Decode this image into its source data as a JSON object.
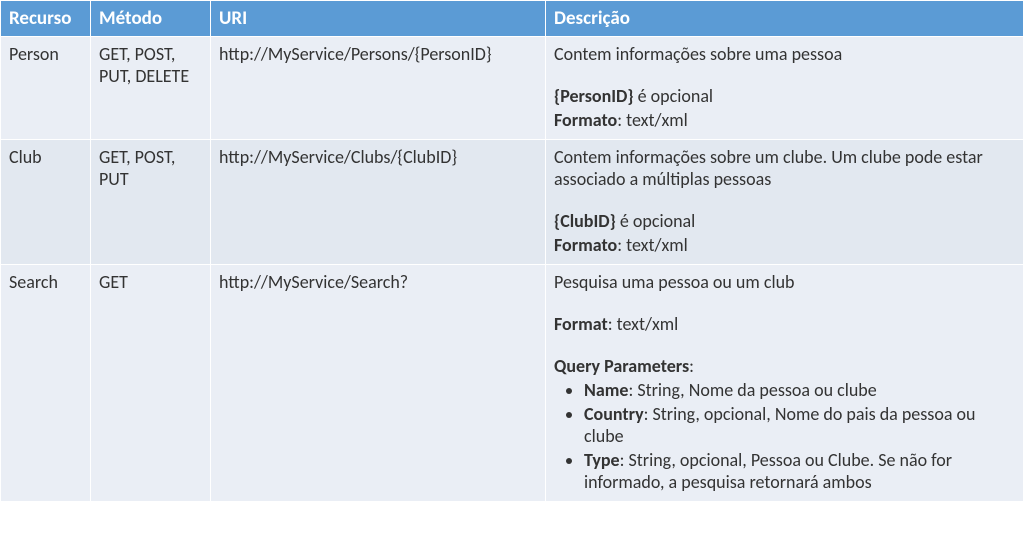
{
  "headers": {
    "recurso": "Recurso",
    "metodo": "Método",
    "uri": "URI",
    "descricao": "Descrição"
  },
  "rows": [
    {
      "recurso": "Person",
      "metodo": "GET, POST, PUT, DELETE",
      "uri": "http://MyService/Persons/{PersonID}",
      "desc": {
        "intro": "Contem informações sobre uma pessoa",
        "param_name": "{PersonID}",
        "param_suffix": " é opcional",
        "format_label": "Formato",
        "format_value": ": text/xml"
      }
    },
    {
      "recurso": "Club",
      "metodo": "GET, POST, PUT",
      "uri": "http://MyService/Clubs/{ClubID}",
      "desc": {
        "intro": "Contem informações sobre um clube. Um clube pode estar associado a múltiplas pessoas",
        "param_name": "{ClubID}",
        "param_suffix": " é opcional",
        "format_label": "Formato",
        "format_value": ": text/xml"
      }
    },
    {
      "recurso": "Search",
      "metodo": "GET",
      "uri": "http://MyService/Search?",
      "desc": {
        "intro": "Pesquisa uma pessoa ou um club",
        "format_label": "Format",
        "format_value": ": text/xml",
        "qp_label": "Query Parameters",
        "qp_colon": ":",
        "params": [
          {
            "name": "Name",
            "text": ": String, Nome da pessoa ou clube"
          },
          {
            "name": "Country",
            "text": ": String, opcional, Nome do pais da pessoa ou clube"
          },
          {
            "name": "Type",
            "text": ": String, opcional, Pessoa ou Clube. Se não for informado, a pesquisa retornará ambos"
          }
        ]
      }
    }
  ]
}
